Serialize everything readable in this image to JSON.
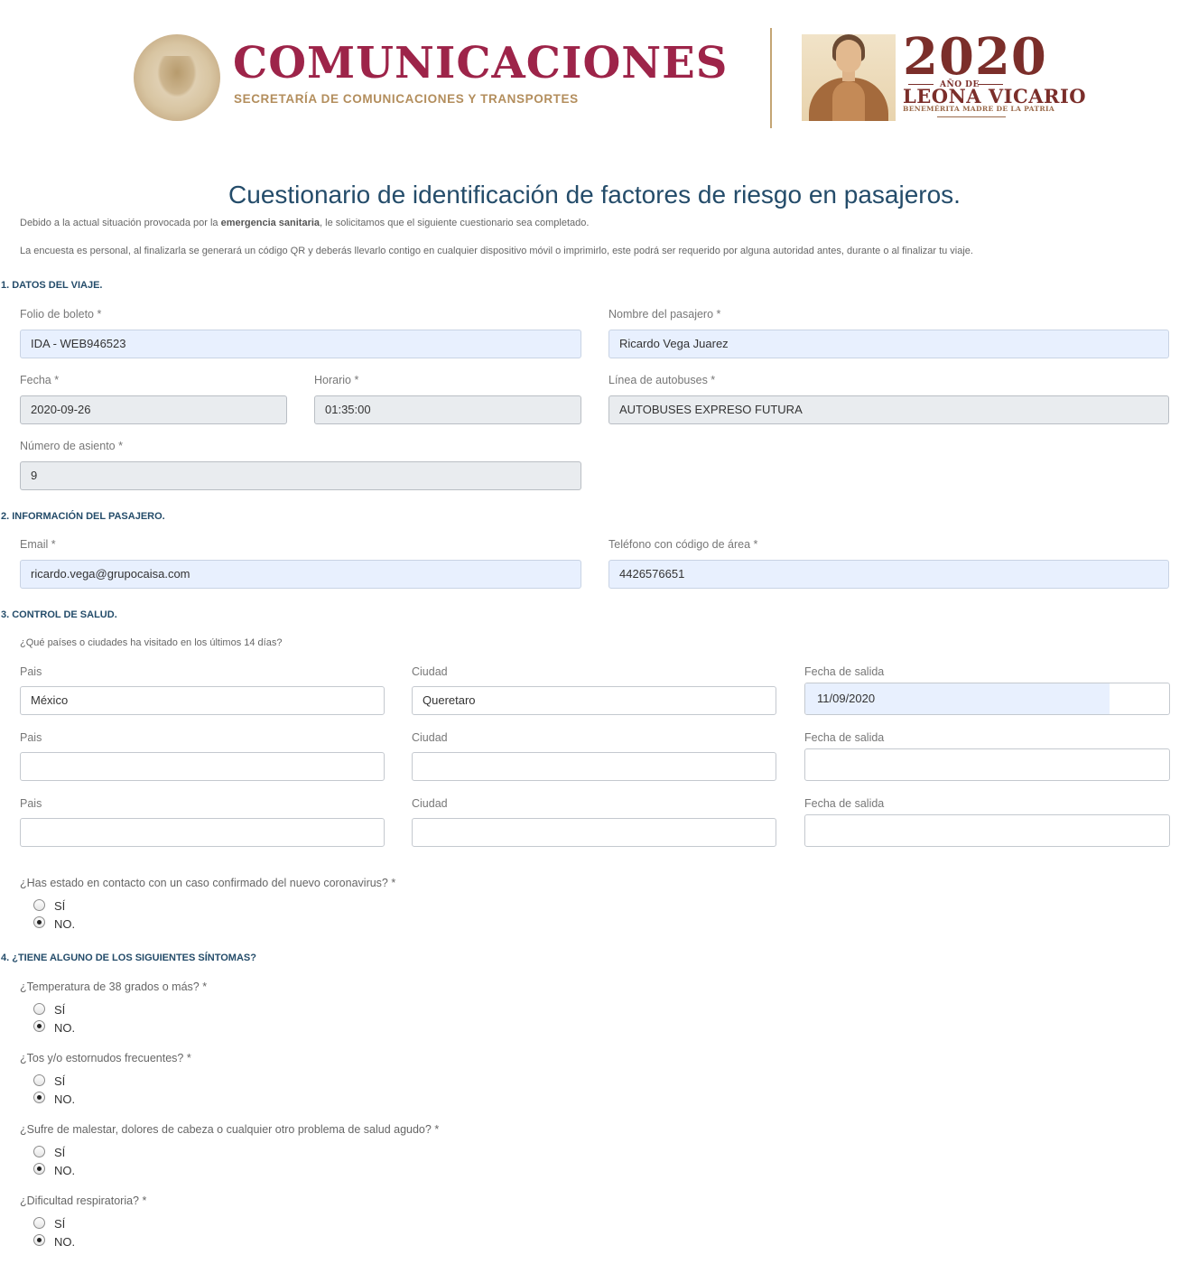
{
  "header": {
    "brand_title": "COMUNICACIONES",
    "brand_subtitle": "SECRETARÍA DE COMUNICACIONES Y TRANSPORTES",
    "year": "2020",
    "year_caption": "AÑO DE",
    "honoree": "LEONA VICARIO",
    "honoree_caption": "BENEMÉRITA MADRE DE LA PATRIA"
  },
  "page_title": "Cuestionario de identificación de factores de riesgo en pasajeros.",
  "intro": {
    "line1_before": "Debido a la actual situación provocada por la ",
    "line1_bold": "emergencia sanitaria",
    "line1_after": ", le solicitamos que el siguiente cuestionario sea completado.",
    "line2": "La encuesta es personal, al finalizarla se generará un código QR y deberás llevarlo contigo en cualquier dispositivo móvil o imprimirlo, este podrá ser requerido por alguna autoridad antes, durante o al finalizar tu viaje."
  },
  "trip": {
    "section_title": "1. DATOS DEL VIAJE.",
    "folio_label": "Folio de boleto *",
    "folio_value": "IDA - WEB946523",
    "passenger_label": "Nombre del pasajero *",
    "passenger_value": "Ricardo Vega Juarez",
    "date_label": "Fecha *",
    "date_value": "2020-09-26",
    "time_label": "Horario *",
    "time_value": "01:35:00",
    "busline_label": "Línea de autobuses *",
    "busline_value": "AUTOBUSES EXPRESO FUTURA",
    "seat_label": "Número de asiento *",
    "seat_value": "9"
  },
  "passenger": {
    "section_title": "2. INFORMACIÓN DEL PASAJERO.",
    "email_label": "Email *",
    "email_value": "ricardo.vega@grupocaisa.com",
    "phone_label": "Teléfono con código de área *",
    "phone_value": "4426576651"
  },
  "health": {
    "section_title": "3. CONTROL DE SALUD.",
    "visited_question": "¿Qué países o ciudades ha visitado en los últimos 14 días?",
    "country_label": "Pais",
    "city_label": "Ciudad",
    "departure_label": "Fecha de salida",
    "visits": [
      {
        "country": "México",
        "city": "Queretaro",
        "departure": "11/09/2020"
      },
      {
        "country": "",
        "city": "",
        "departure": ""
      },
      {
        "country": "",
        "city": "",
        "departure": ""
      }
    ],
    "contact_question": "¿Has estado en contacto con un caso confirmado del nuevo coronavirus? *",
    "contact_answer": "NO."
  },
  "symptoms": {
    "section_title": "4. ¿TIENE ALGUNO DE LOS SIGUIENTES SÍNTOMAS?",
    "questions": [
      {
        "text": "¿Temperatura de 38 grados o más? *",
        "answer": "NO."
      },
      {
        "text": "¿Tos y/o estornudos frecuentes? *",
        "answer": "NO."
      },
      {
        "text": "¿Sufre de malestar, dolores de cabeza o cualquier otro problema de salud agudo? *",
        "answer": "NO."
      },
      {
        "text": "¿Dificultad respiratoria? *",
        "answer": "NO."
      }
    ]
  },
  "options": {
    "yes": "SÍ",
    "no": "NO."
  }
}
